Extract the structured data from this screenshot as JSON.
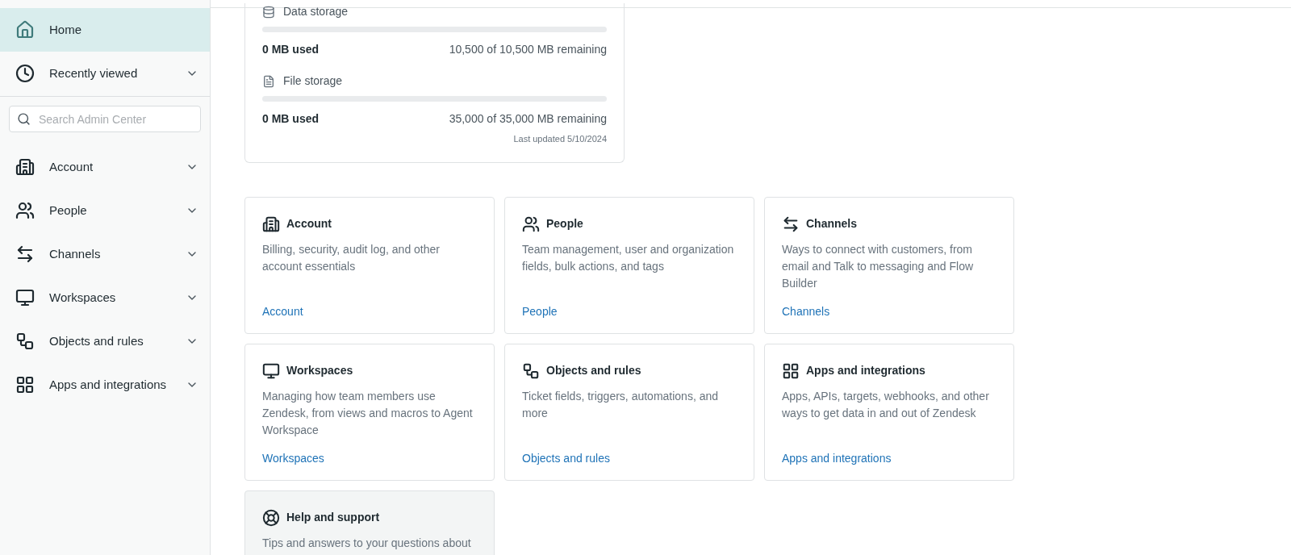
{
  "sidebar": {
    "items": [
      {
        "label": "Home",
        "selected": true
      },
      {
        "label": "Recently viewed",
        "selected": false,
        "expanded": false
      }
    ],
    "search": {
      "placeholder": "Search Admin Center"
    },
    "sections": [
      {
        "label": "Account",
        "selected": false,
        "expanded": false
      },
      {
        "label": "People",
        "selected": false,
        "expanded": false
      },
      {
        "label": "Channels",
        "selected": false,
        "expanded": false
      },
      {
        "label": "Workspaces",
        "selected": false,
        "expanded": false
      },
      {
        "label": "Objects and rules",
        "selected": false,
        "expanded": false
      },
      {
        "label": "Apps and integrations",
        "selected": false,
        "expanded": false
      }
    ]
  },
  "storage": {
    "meters": [
      {
        "title": "Data storage",
        "level": 0,
        "used": "0 MB used",
        "remaining": "10,500 of 10,500 MB remaining"
      },
      {
        "title": "File storage",
        "level": 0,
        "used": "0 MB used",
        "remaining": "35,000 of 35,000 MB remaining"
      }
    ],
    "updated": "Last updated 5/10/2024"
  },
  "cards": [
    {
      "title": "Account",
      "description": "Billing, security, audit log, and other account essentials",
      "link": "Account",
      "highlighted": false
    },
    {
      "title": "People",
      "description": "Team management, user and organization fields, bulk actions, and tags",
      "link": "People",
      "highlighted": false
    },
    {
      "title": "Channels",
      "description": "Ways to connect with customers, from email and Talk to messaging and Flow Builder",
      "link": "Channels",
      "highlighted": false
    },
    {
      "title": "Workspaces",
      "description": "Managing how team members use Zendesk, from views and macros to Agent Workspace",
      "link": "Workspaces",
      "highlighted": false
    },
    {
      "title": "Objects and rules",
      "description": "Ticket fields, triggers, automations, and more",
      "link": "Objects and rules",
      "highlighted": false
    },
    {
      "title": "Apps and integrations",
      "description": "Apps, APIs, targets, webhooks, and other ways to get data in and out of Zendesk",
      "link": "Apps and integrations",
      "highlighted": false
    },
    {
      "title": "Help and support",
      "description": "Tips and answers to your questions about",
      "highlighted": true
    }
  ]
}
